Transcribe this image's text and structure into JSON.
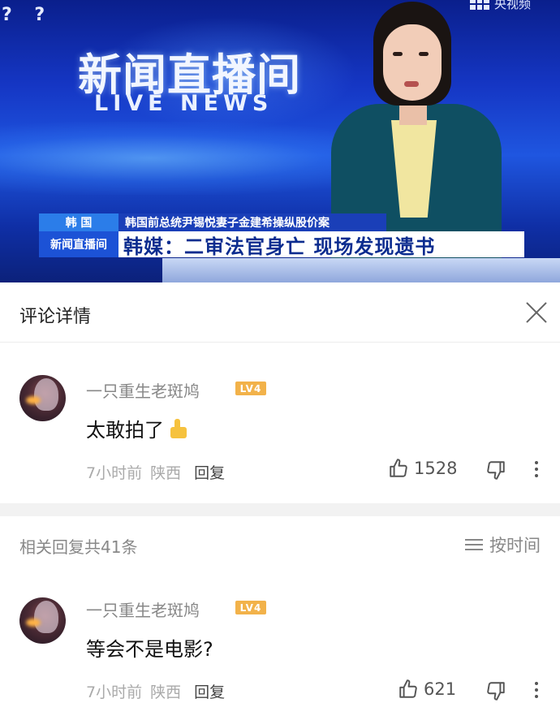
{
  "video": {
    "corner_marks": "? ?",
    "channel_label": "央视频",
    "logo_cn": "新闻直播间",
    "logo_en": "LIVE NEWS",
    "tag_region": "韩 国",
    "subheadline": "韩国前总统尹锡悦妻子金建希操纵股价案",
    "tag_logo": "新闻直播间",
    "headline": "韩媒：二审法官身亡 现场发现遗书"
  },
  "panel": {
    "title": "评论详情"
  },
  "comment": {
    "username": "一只重生老斑鸠",
    "level": "LV4",
    "text": "太敢拍了",
    "time": "7小时前",
    "location": "陕西",
    "reply_label": "回复",
    "likes": "1528"
  },
  "replies": {
    "count_label": "相关回复共41条",
    "sort_label": "按时间"
  },
  "reply": {
    "username": "一只重生老斑鸠",
    "level": "LV4",
    "text": "等会不是电影?",
    "time": "7小时前",
    "location": "陕西",
    "reply_label": "回复",
    "likes": "621"
  },
  "colors": {
    "video_blue": "#1536c4",
    "headline_blue": "#0b2c8f",
    "level_badge": "#f2b24a"
  },
  "icons": [
    "close-icon",
    "thumbs-up-icon",
    "thumbs-down-icon",
    "more-icon",
    "sort-icon",
    "thumbs-up-emoji"
  ]
}
